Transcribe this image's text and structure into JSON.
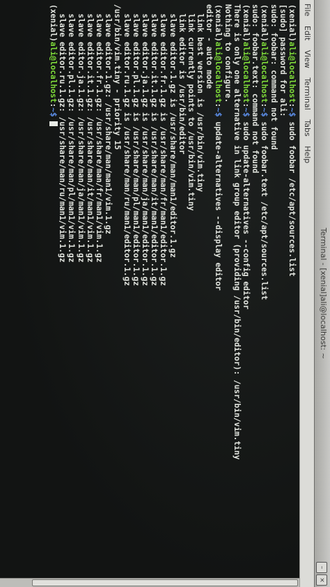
{
  "window": {
    "title": "Terminal - [xenial]ali@localhost: ~"
  },
  "menu": [
    "File",
    "Edit",
    "View",
    "Terminal",
    "Tabs",
    "Help"
  ],
  "prompt": {
    "chroot": "(xenial)",
    "user_host": "ali@localhost",
    "path": "~",
    "symbol": "$"
  },
  "terminal_lines": [
    {
      "type": "prompt",
      "command": " sudo foobar /etc/apt/sources.list"
    },
    {
      "type": "output",
      "text": "[sudo] password for ali:"
    },
    {
      "type": "output",
      "text": "sudo: foobar: command not found"
    },
    {
      "type": "prompt",
      "command": " sudo foobar.text /etc/apt/sources.list"
    },
    {
      "type": "output",
      "text": "sudo: foobar.text: command not found"
    },
    {
      "type": "prompt",
      "command": " sudo update-alternatives --config editor"
    },
    {
      "type": "output",
      "text": "There is only one alternative in link group editor (providing /usr/bin/editor): /usr/bin/vim.tiny"
    },
    {
      "type": "output",
      "text": "Nothing to configure."
    },
    {
      "type": "prompt",
      "command": " update-alternatives --display editor"
    },
    {
      "type": "output",
      "text": "editor - auto mode"
    },
    {
      "type": "output",
      "text": "  link best version is /usr/bin/vim.tiny"
    },
    {
      "type": "output",
      "text": "  link currently points to /usr/bin/vim.tiny"
    },
    {
      "type": "output",
      "text": "  link editor is /usr/bin/editor"
    },
    {
      "type": "output",
      "text": "  slave editor.1.gz is /usr/share/man/man1/editor.1.gz"
    },
    {
      "type": "output",
      "text": "  slave editor.fr.1.gz is /usr/share/man/fr/man1/editor.1.gz"
    },
    {
      "type": "output",
      "text": "  slave editor.it.1.gz is /usr/share/man/it/man1/editor.1.gz"
    },
    {
      "type": "output",
      "text": "  slave editor.ja.1.gz is /usr/share/man/ja/man1/editor.1.gz"
    },
    {
      "type": "output",
      "text": "  slave editor.pl.1.gz is /usr/share/man/pl/man1/editor.1.gz"
    },
    {
      "type": "output",
      "text": "  slave editor.ru.1.gz is /usr/share/man/ru/man1/editor.1.gz"
    },
    {
      "type": "output",
      "text": "/usr/bin/vim.tiny - priority 15"
    },
    {
      "type": "output",
      "text": "  slave editor.1.gz: /usr/share/man/man1/vim.1.gz"
    },
    {
      "type": "output",
      "text": "  slave editor.fr.1.gz: /usr/share/man/fr/man1/vim.1.gz"
    },
    {
      "type": "output",
      "text": "  slave editor.it.1.gz: /usr/share/man/it/man1/vim.1.gz"
    },
    {
      "type": "output",
      "text": "  slave editor.ja.1.gz: /usr/share/man/ja/man1/vim.1.gz"
    },
    {
      "type": "output",
      "text": "  slave editor.pl.1.gz: /usr/share/man/pl/man1/vim.1.gz"
    },
    {
      "type": "output",
      "text": "  slave editor.ru.1.gz: /usr/share/man/ru/man1/vim.1.gz"
    },
    {
      "type": "prompt",
      "command": " ",
      "cursor": true
    }
  ],
  "colors": {
    "prompt_user": "#7fdc3a",
    "prompt_path": "#5c8ee8",
    "text": "#e3e6e0",
    "background": "#141615"
  }
}
